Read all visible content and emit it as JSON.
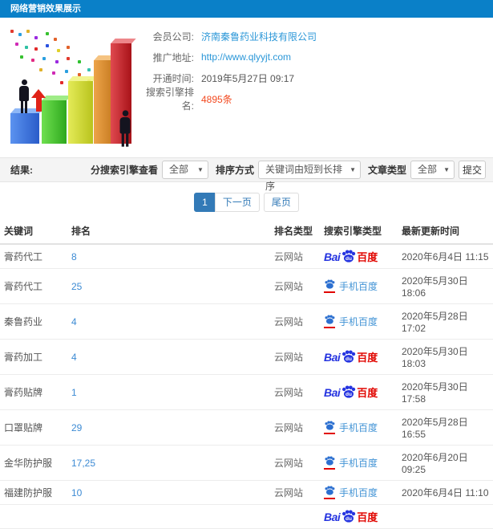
{
  "header": {
    "title": "网络营销效果展示"
  },
  "info": {
    "rows": [
      {
        "label": "会员公司:",
        "value": "济南秦鲁药业科技有限公司",
        "style": "link"
      },
      {
        "label": "推广地址:",
        "value": "http://www.qlyyjt.com",
        "style": "link"
      },
      {
        "label": "开通时间:",
        "value": "2019年5月27日 09:17",
        "style": "plain"
      },
      {
        "label": "搜索引擎排名:",
        "value": "4895条",
        "style": "rank-red"
      }
    ]
  },
  "filters": {
    "section_label": "结果:",
    "engine_label": "分搜索引擎查看",
    "engine_value": "全部",
    "sort_label": "排序方式",
    "sort_value": "关键词由短到长排序",
    "article_label": "文章类型",
    "article_value": "全部",
    "submit_label": "提交",
    "caret": "▼"
  },
  "pagination": {
    "current": "1",
    "next": "下一页",
    "last": "尾页"
  },
  "table": {
    "headers": [
      "关键词",
      "排名",
      "排名类型",
      "搜索引擎类型",
      "最新更新时间"
    ],
    "logos": {
      "baidu_pc": {
        "bai": "Bai",
        "du": "du",
        "cn": "百度"
      },
      "baidu_mobile": {
        "label": "手机百度"
      }
    },
    "rows": [
      {
        "keyword": "膏药代工",
        "rank": "8",
        "rank_type": "云网站",
        "engine": "baidu_pc",
        "time": "2020年6月4日 11:15"
      },
      {
        "keyword": "膏药代工",
        "rank": "25",
        "rank_type": "云网站",
        "engine": "baidu_mobile",
        "time": "2020年5月30日 18:06"
      },
      {
        "keyword": "秦鲁药业",
        "rank": "4",
        "rank_type": "云网站",
        "engine": "baidu_mobile",
        "time": "2020年5月28日 17:02"
      },
      {
        "keyword": "膏药加工",
        "rank": "4",
        "rank_type": "云网站",
        "engine": "baidu_pc",
        "time": "2020年5月30日 18:03"
      },
      {
        "keyword": "膏药贴牌",
        "rank": "1",
        "rank_type": "云网站",
        "engine": "baidu_pc",
        "time": "2020年5月30日 17:58"
      },
      {
        "keyword": "口罩贴牌",
        "rank": "29",
        "rank_type": "云网站",
        "engine": "baidu_mobile",
        "time": "2020年5月28日 16:55"
      },
      {
        "keyword": "金华防护服",
        "rank": "17,25",
        "rank_type": "云网站",
        "engine": "baidu_mobile",
        "time": "2020年6月20日 09:25"
      },
      {
        "keyword": "福建防护服",
        "rank": "10",
        "rank_type": "云网站",
        "engine": "baidu_mobile",
        "time": "2020年6月4日 11:10"
      },
      {
        "keyword": "",
        "rank": "",
        "rank_type": "",
        "engine": "baidu_pc",
        "time": ""
      }
    ]
  },
  "colors": {
    "header_bg": "#0a80c8",
    "link_blue": "#2b97d8",
    "accent_blue": "#337ab7",
    "rank_red": "#f3491f",
    "baidu_blue": "#2534e0",
    "baidu_red": "#e10601"
  }
}
